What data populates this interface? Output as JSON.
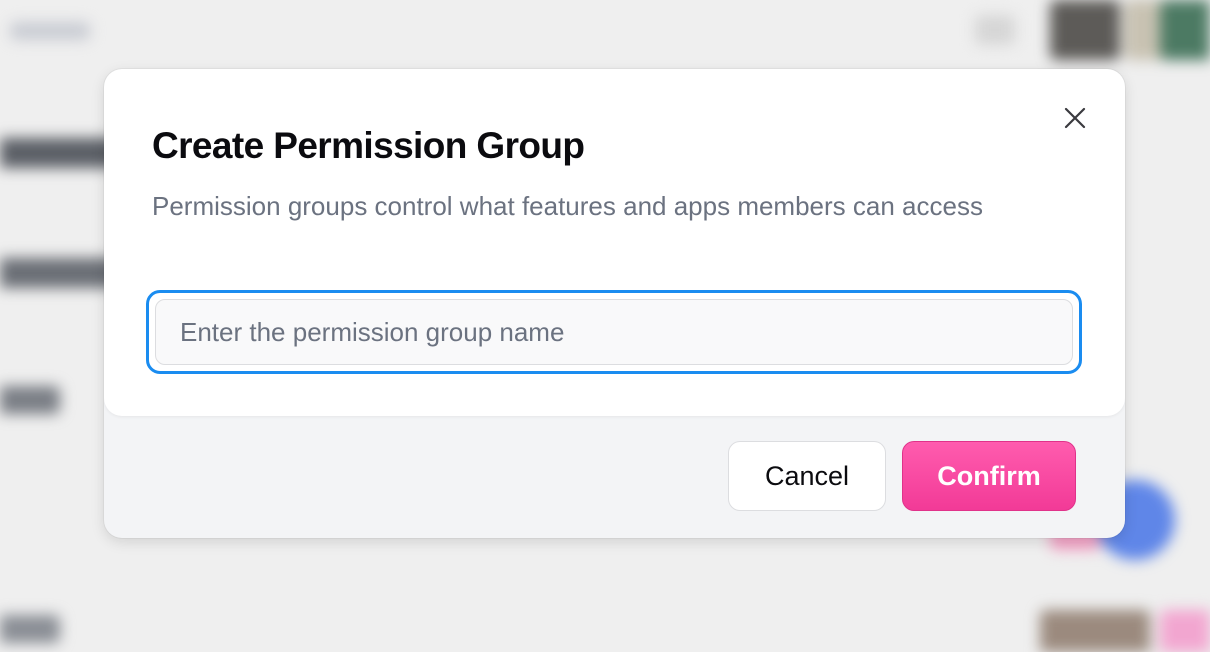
{
  "dialog": {
    "title": "Create Permission Group",
    "description": "Permission groups control what features and apps members can access",
    "close_icon": "close-icon",
    "name_input": {
      "value": "",
      "placeholder": "Enter the permission group name"
    },
    "cancel_label": "Cancel",
    "confirm_label": "Confirm"
  },
  "colors": {
    "accent_focus": "#1a8cf0",
    "confirm_bg": "#f23a97",
    "title_text": "#0b0b0f",
    "description_text": "#6b7280"
  }
}
